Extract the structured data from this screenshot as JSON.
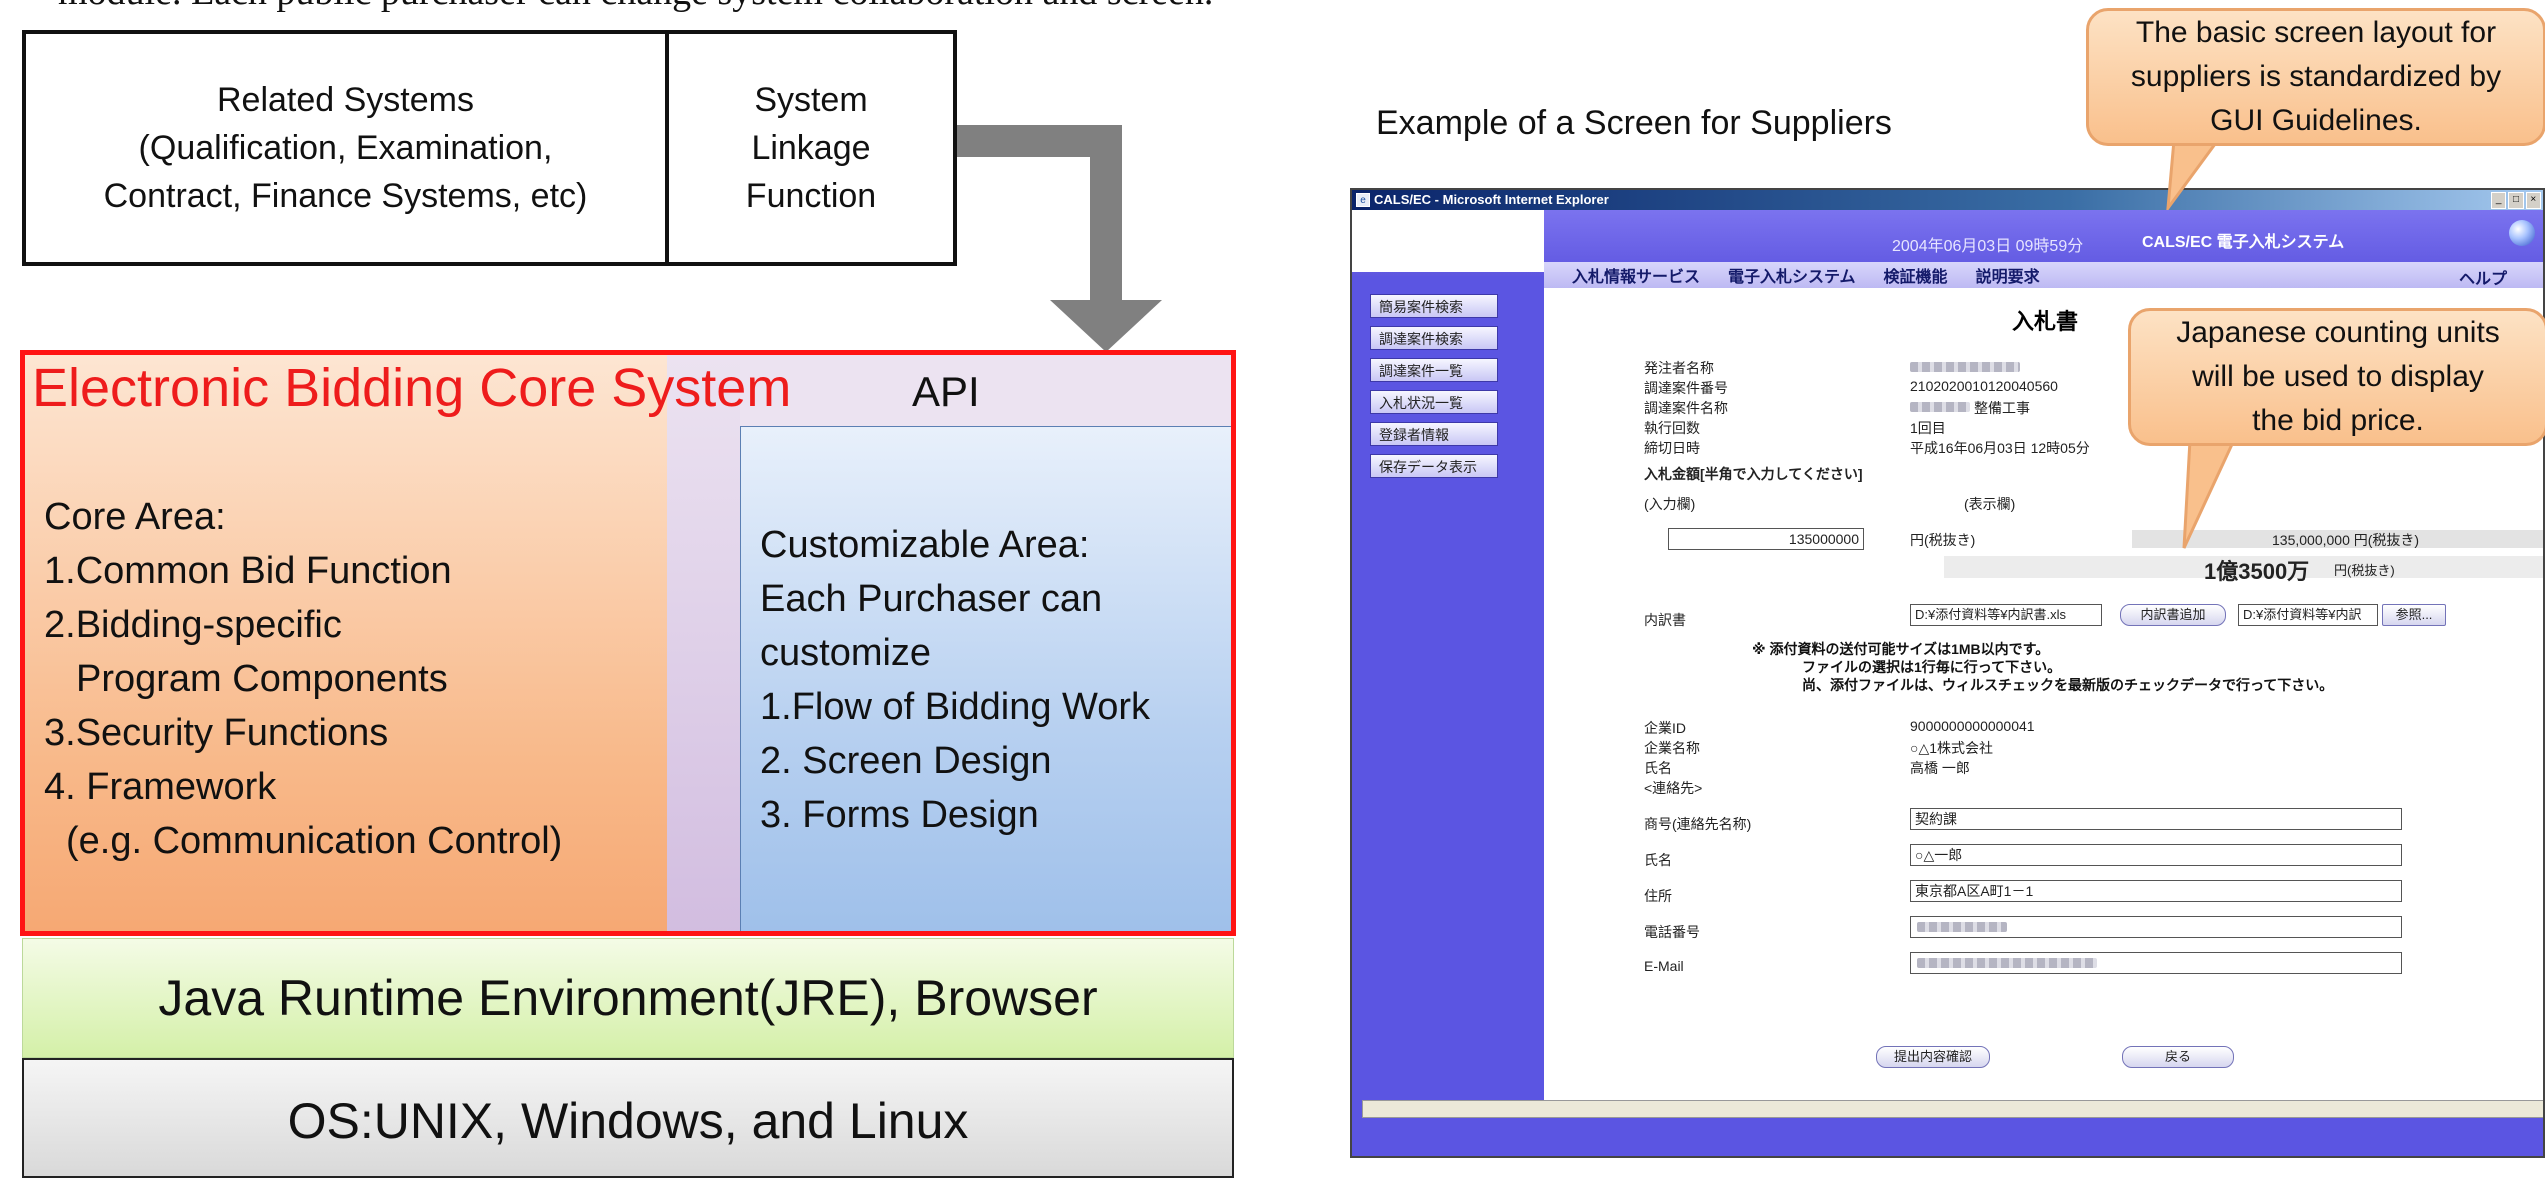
{
  "top_caption": "module. Each public purchaser can change system collaboration and screen.",
  "diagram": {
    "related_systems": [
      "Related Systems",
      "(Qualification, Examination,",
      "Contract, Finance Systems, etc)"
    ],
    "linkage": [
      "System",
      "Linkage",
      "Function"
    ],
    "core_title": "Electronic Bidding Core System",
    "api_label": "API",
    "core_area": [
      "Core Area:",
      "1.Common Bid Function",
      "2.Bidding-specific",
      "Program Components",
      "3.Security Functions",
      "4. Framework",
      "(e.g. Communication Control)"
    ],
    "customizable_area": [
      "Customizable Area:",
      "Each Purchaser can",
      "customize",
      "1.Flow of Bidding Work",
      "2. Screen Design",
      "3. Forms Design"
    ],
    "jre": "Java Runtime Environment(JRE), Browser",
    "os": "OS:UNIX, Windows, and Linux"
  },
  "supplier_screen": {
    "title": "Example of a Screen for Suppliers",
    "window_title": "CALS/EC - Microsoft Internet Explorer",
    "header_date": "2004年06月03日 09時59分",
    "header_system": "CALS/EC 電子入札システム",
    "nav": [
      "入札情報サービス",
      "電子入札システム",
      "検証機能",
      "説明要求"
    ],
    "nav_help": "ヘルプ",
    "side_buttons": [
      "簡易案件検索",
      "調達案件検索",
      "調達案件一覧",
      "入札状況一覧",
      "登録者情報",
      "保存データ表示"
    ],
    "form_heading": "入札書",
    "fields": {
      "orderer_label": "発注者名称",
      "case_no_label": "調達案件番号",
      "case_no_value": "2102020010120040560",
      "case_name_label": "調達案件名称",
      "case_name_value": "整備工事",
      "round_label": "執行回数",
      "round_value": "1回目",
      "deadline_label": "締切日時",
      "deadline_value": "平成16年06月03日 12時05分",
      "amount_label": "入札金額[半角で入力してください]",
      "input_col": "(入力欄)",
      "display_col": "(表示欄)",
      "amount_input": "135000000",
      "tax_excl": "円(税抜き)",
      "amount_display": "135,000,000 円(税抜き)",
      "amount_kanji": "1億3500万",
      "amount_kanji_unit": "円(税抜き)",
      "breakdown_label": "内訳書",
      "breakdown_path": "D:¥添付資料等¥内訳書.xls",
      "breakdown_add_btn": "内訳書追加",
      "breakdown_path2": "D:¥添付資料等¥内訳",
      "browse_btn": "参照...",
      "note_lines": [
        "※ 添付資料の送付可能サイズは1MB以内です。",
        "ファイルの選択は1行毎に行って下さい。",
        "尚、添付ファイルは、ウィルスチェックを最新版のチェックデータで行って下さい。"
      ],
      "company_id_label": "企業ID",
      "company_id_value": "9000000000000041",
      "company_name_label": "企業名称",
      "company_name_value": "○△1株式会社",
      "person_label": "氏名",
      "person_value": "高橋 一郎",
      "contact_label": "<連絡先>",
      "trade_label": "商号(連絡先名称)",
      "trade_value": "契約課",
      "contact_name_label": "氏名",
      "contact_name_value": "○△一郎",
      "address_label": "住所",
      "address_value": "東京都A区A町1－1",
      "phone_label": "電話番号",
      "email_label": "E-Mail",
      "submit_btn": "提出内容確認",
      "back_btn": "戻る"
    }
  },
  "callouts": {
    "layout_note": [
      "The basic screen layout for",
      "suppliers is standardized by",
      "GUI Guidelines."
    ],
    "units_note": [
      "Japanese counting units",
      "will be used to display",
      "the bid price."
    ]
  },
  "colors": {
    "core_border": "#ff1414",
    "core_title": "#ee1c1c",
    "arrow": "#808080",
    "app_purple": "#5b55e2",
    "callout_fill": "#f9c08c"
  }
}
